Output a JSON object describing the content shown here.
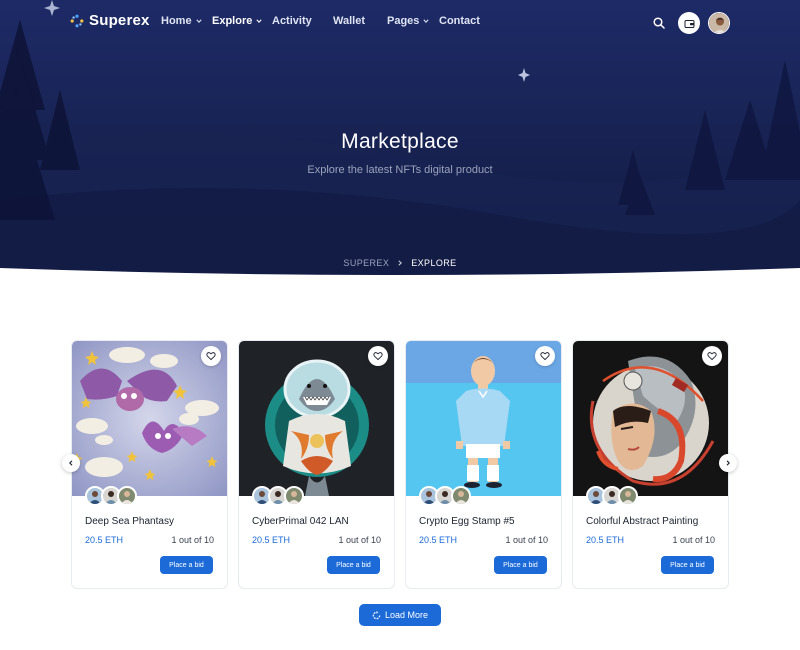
{
  "nav": {
    "brand": "Superex",
    "items": [
      {
        "label": "Home",
        "has_dropdown": true,
        "active": false
      },
      {
        "label": "Explore",
        "has_dropdown": true,
        "active": true
      },
      {
        "label": "Activity",
        "has_dropdown": false,
        "active": false
      },
      {
        "label": "Wallet",
        "has_dropdown": false,
        "active": false
      },
      {
        "label": "Pages",
        "has_dropdown": true,
        "active": false
      },
      {
        "label": "Contact",
        "has_dropdown": false,
        "active": false
      }
    ],
    "icons": [
      "search-icon",
      "wallet-icon",
      "user-avatar"
    ]
  },
  "hero": {
    "title": "Marketplace",
    "subtitle": "Explore the latest NFTs digital product",
    "breadcrumb": [
      "SUPEREX",
      "EXPLORE"
    ]
  },
  "cards": [
    {
      "title": "Deep Sea Phantasy",
      "price": "20.5 ETH",
      "edition": "1 out of 10",
      "button": "Place a bid"
    },
    {
      "title": "CyberPrimal 042 LAN",
      "price": "20.5 ETH",
      "edition": "1 out of 10",
      "button": "Place a bid"
    },
    {
      "title": "Crypto Egg Stamp #5",
      "price": "20.5 ETH",
      "edition": "1 out of 10",
      "button": "Place a bid"
    },
    {
      "title": "Colorful Abstract Painting",
      "price": "20.5 ETH",
      "edition": "1 out of 10",
      "button": "Place a bid"
    }
  ],
  "load_more": "Load More",
  "colors": {
    "hero_bg": "#141c44",
    "accent": "#1b6ad8",
    "text_dark": "#1c2230"
  }
}
